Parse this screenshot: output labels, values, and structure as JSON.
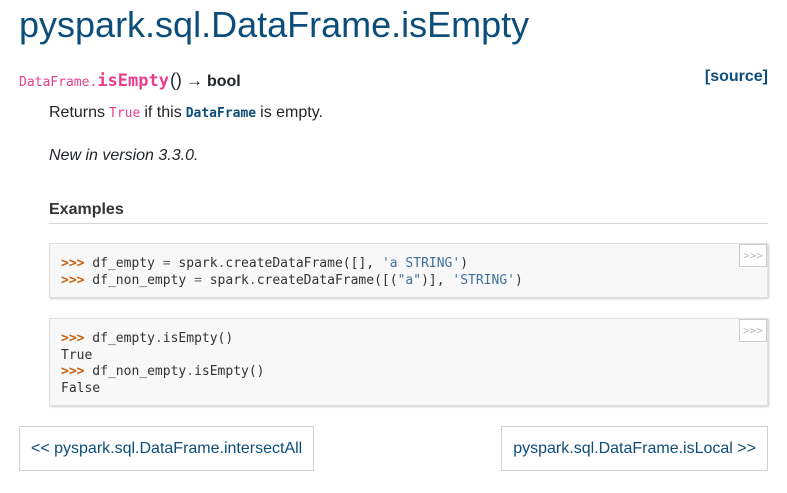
{
  "page_title": "pyspark.sql.DataFrame.isEmpty",
  "signature": {
    "prefix": "DataFrame.",
    "name": "isEmpty",
    "parens": "()",
    "arrow": "→",
    "return_type": "bool"
  },
  "source_link": "[source]",
  "description": {
    "before": "Returns",
    "code_true": "True",
    "middle": "if this",
    "code_dataframe": "DataFrame",
    "after": "is empty."
  },
  "version_added": "New in version 3.3.0.",
  "examples_heading": "Examples",
  "code_blocks": [
    {
      "copy_label": ">>>",
      "lines": [
        {
          "prompt": ">>>",
          "p1": " df_empty ",
          "op1": "=",
          "p2": " spark",
          "op2": ".",
          "p3": "createDataFrame([], ",
          "str1": "'a STRING'",
          "p4": ")"
        },
        {
          "prompt": ">>>",
          "p1": " df_non_empty ",
          "op1": "=",
          "p2": " spark",
          "op2": ".",
          "p3": "createDataFrame([(",
          "str1": "\"a\"",
          "p4": ")], ",
          "str2": "'STRING'",
          "p5": ")"
        }
      ]
    },
    {
      "copy_label": ">>>",
      "lines": [
        {
          "prompt": ">>>",
          "p1": " df_empty",
          "op1": ".",
          "p2": "isEmpty()"
        },
        {
          "output": "True"
        },
        {
          "prompt": ">>>",
          "p1": " df_non_empty",
          "op1": ".",
          "p2": "isEmpty()"
        },
        {
          "output": "False"
        }
      ]
    }
  ],
  "nav": {
    "prev": "<< pyspark.sql.DataFrame.intersectAll",
    "next": "pyspark.sql.DataFrame.isLocal >>"
  }
}
